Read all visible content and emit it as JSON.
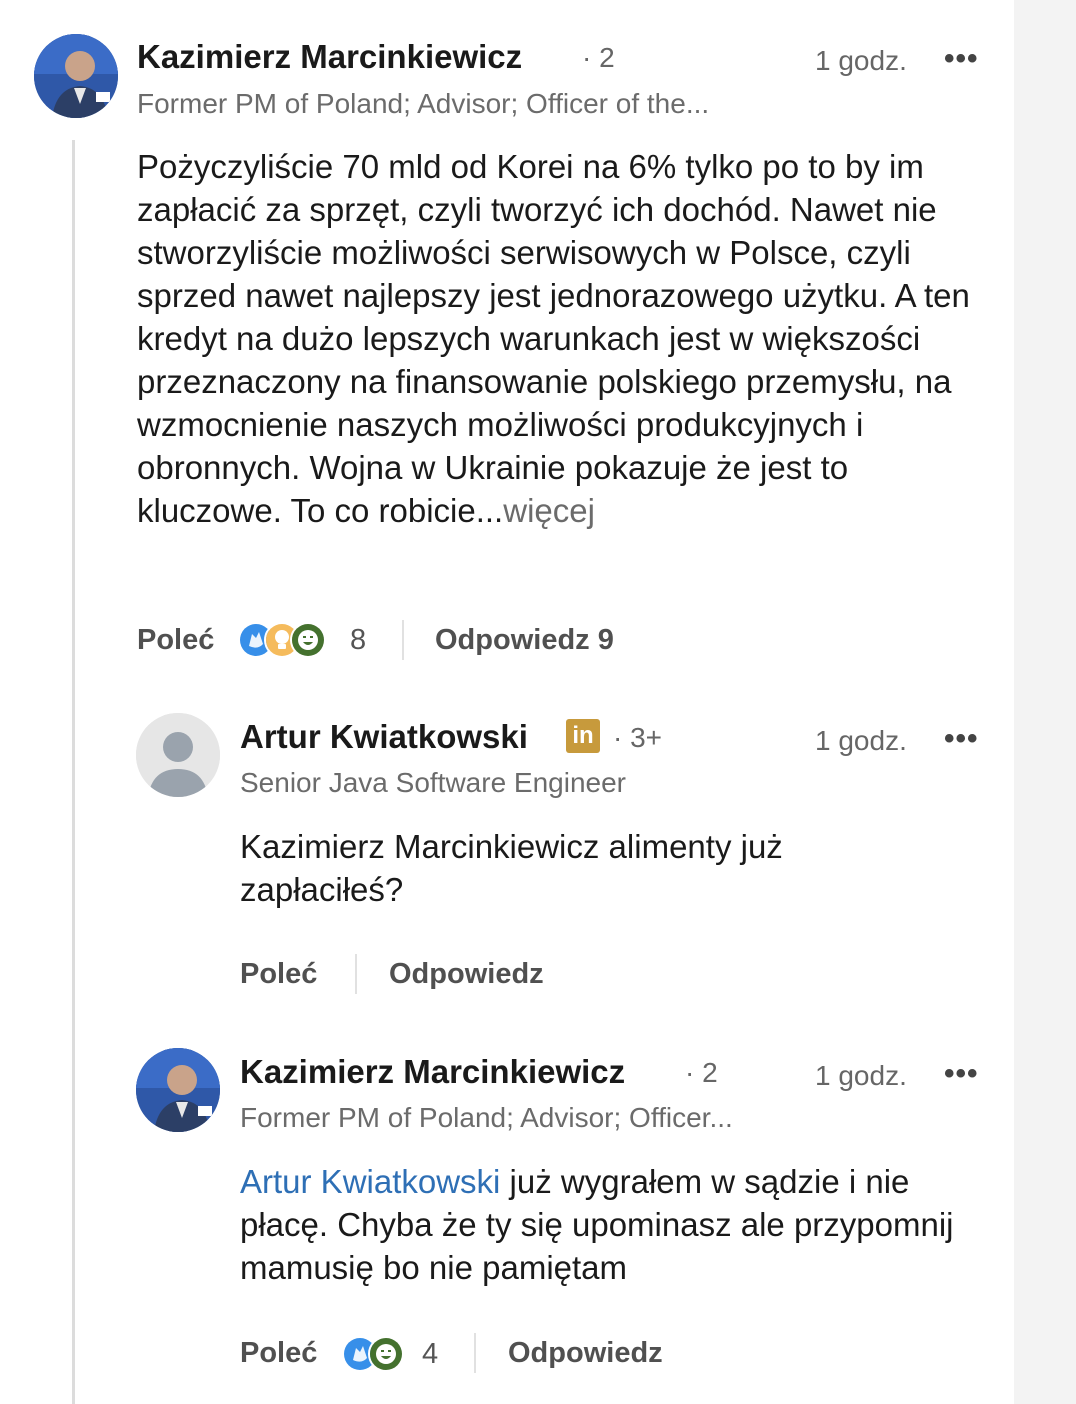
{
  "comments": [
    {
      "author": "Kazimierz Marcinkiewicz",
      "degree": "· 2",
      "time": "1 godz.",
      "more": "•••",
      "headline": "Former PM of Poland; Advisor; Officer of the...",
      "text": "Pożyczyliście 70 mld od Korei na 6% tylko po to by im zapłacić za sprzęt, czyli tworzyć ich dochód. Nawet nie stworzyliście możliwości serwisowych w Polsce, czyli sprzed nawet najlepszy jest jednorazowego użytku. A ten kredyt na dużo lepszych warunkach jest w większości przeznaczony na finansowanie polskiego przemysłu, na wzmocnienie naszych możliwości produkcyjnych i obronnych. Wojna w Ukrainie pokazuje że jest to kluczowe. To co robicie...",
      "more_link": "więcej",
      "like_label": "Poleć",
      "reaction_icons": [
        "clap-icon",
        "lightbulb-icon",
        "laugh-icon"
      ],
      "reaction_count": "8",
      "reply_label": "Odpowiedz 9"
    },
    {
      "author": "Artur Kwiatkowski",
      "badge": "in",
      "degree": "· 3+",
      "time": "1 godz.",
      "more": "•••",
      "headline": "Senior Java Software Engineer",
      "text": "Kazimierz Marcinkiewicz  alimenty już zapłaciłeś?",
      "like_label": "Poleć",
      "reply_label": "Odpowiedz"
    },
    {
      "author": "Kazimierz Marcinkiewicz",
      "degree": "· 2",
      "time": "1 godz.",
      "more": "•••",
      "headline": "Former PM of Poland; Advisor; Officer...",
      "mention": "Artur Kwiatkowski",
      "text": " już wygrałem w sądzie i nie płacę. Chyba że ty się upominasz ale przypomnij mamusię bo nie pamiętam",
      "like_label": "Poleć",
      "reaction_icons": [
        "clap-icon",
        "laugh-icon"
      ],
      "reaction_count": "4",
      "reply_label": "Odpowiedz"
    }
  ],
  "colors": {
    "mention": "#2e6fb5",
    "clap": "#378fe9",
    "lightbulb": "#f5bb5c",
    "laugh": "#44712e"
  }
}
